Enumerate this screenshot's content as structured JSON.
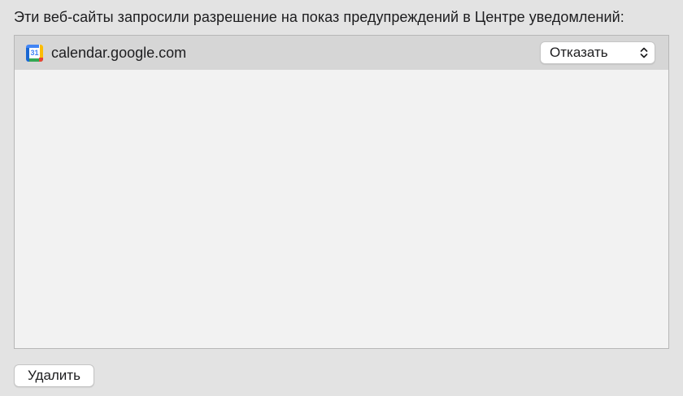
{
  "prompt_text": "Эти веб-сайты запросили разрешение на показ предупреждений в Центре уведомлений:",
  "sites": [
    {
      "icon": "google-calendar-icon",
      "icon_day": "31",
      "domain": "calendar.google.com",
      "permission": "Отказать"
    }
  ],
  "buttons": {
    "remove_label": "Удалить"
  },
  "colors": {
    "window_bg": "#e3e3e3",
    "list_bg": "#f2f2f2",
    "selected_row_bg": "#d6d6d6"
  }
}
